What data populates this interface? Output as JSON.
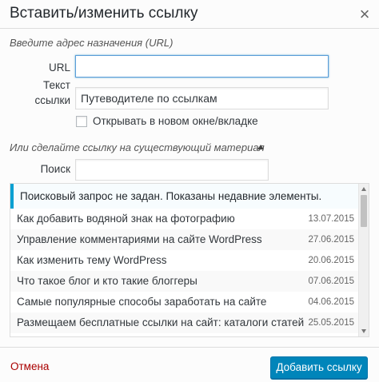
{
  "dialog": {
    "title": "Вставить/изменить ссылку",
    "close_icon": "×"
  },
  "url_section": {
    "heading": "Введите адрес назначения (URL)",
    "url_label": "URL",
    "url_value": "",
    "text_label_line1": "Текст",
    "text_label_line2": "ссылки",
    "text_value": "Путеводителе по ссылкам",
    "new_tab_label": "Открывать в новом окне/вкладке",
    "new_tab_checked": false
  },
  "search_section": {
    "toggle_label": "Или сделайте ссылку на существующий материал",
    "toggle_icon": "arrow-up-icon",
    "search_label": "Поиск",
    "search_value": ""
  },
  "results": {
    "notice": "Поисковый запрос не задан. Показаны недавние элементы.",
    "items": [
      {
        "title": "Как добавить водяной знак на фотографию",
        "date": "13.07.2015"
      },
      {
        "title": "Управление комментариями на сайте WordPress",
        "date": "27.06.2015"
      },
      {
        "title": "Как изменить тему WordPress",
        "date": "20.06.2015"
      },
      {
        "title": "Что такое блог и кто такие блоггеры",
        "date": "07.06.2015"
      },
      {
        "title": "Самые популярные способы заработать на сайте",
        "date": "04.06.2015"
      },
      {
        "title": "Размещаем бесплатные ссылки на сайт: каталоги статей",
        "date": "25.05.2015"
      }
    ]
  },
  "footer": {
    "cancel_label": "Отмена",
    "submit_label": "Добавить ссылку"
  },
  "colors": {
    "accent": "#0085ba",
    "notice_border": "#00a0d2",
    "cancel": "#aa0000"
  }
}
